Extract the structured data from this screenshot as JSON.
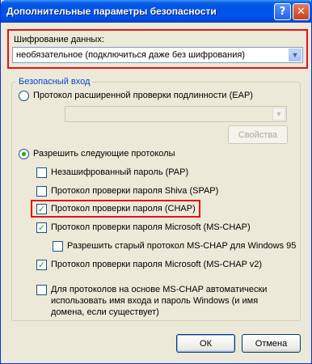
{
  "window": {
    "title": "Дополнительные параметры безопасности",
    "help_glyph": "?",
    "close_glyph": "✕"
  },
  "encryption": {
    "label": "Шифрование данных:",
    "selected": "необязательное (подключиться даже без шифрования)"
  },
  "secure_logon": {
    "group_title": "Безопасный вход",
    "eap_option": "Протокол расширенной проверки подлинности (EAP)",
    "eap_select_value": "",
    "properties_button": "Свойства",
    "allow_option": "Разрешить следующие протоколы",
    "protocols": [
      {
        "label": "Незашифрованный пароль (PAP)",
        "checked": false
      },
      {
        "label": "Протокол проверки пароля Shiva (SPAP)",
        "checked": false
      },
      {
        "label": "Протокол проверки пароля (CHAP)",
        "checked": true
      },
      {
        "label": "Протокол проверки пароля Microsoft (MS-CHAP)",
        "checked": true
      },
      {
        "label": "Разрешить старый протокол MS-CHAP для Windows 95",
        "checked": false
      },
      {
        "label": "Протокол проверки пароля Microsoft (MS-CHAP v2)",
        "checked": true
      }
    ],
    "auto_windows_logon": {
      "line1": "Для протоколов на основе MS-CHAP автоматически",
      "line2": "использовать имя входа и пароль Windows (и имя",
      "line3": "домена, если существует)",
      "checked": false
    }
  },
  "buttons": {
    "ok": "ОК",
    "cancel": "Отмена"
  },
  "highlight_color": "#e3101b",
  "check_glyph": "✓"
}
